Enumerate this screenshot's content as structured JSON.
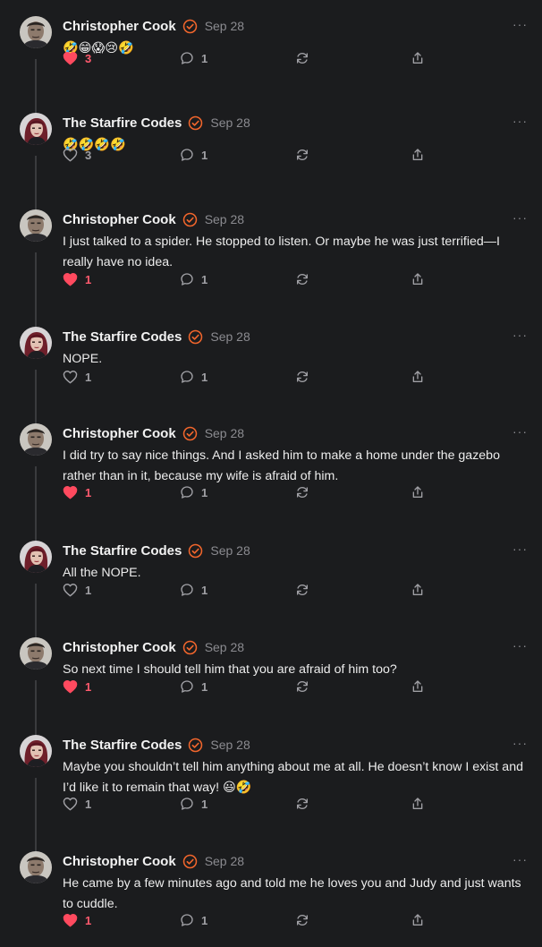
{
  "colors": {
    "background": "#1b1c1e",
    "text": "#ececec",
    "muted": "#8b8b90",
    "liked_heart": "#ff4a5f",
    "verified_badge": "#f2662c"
  },
  "icons": {
    "verified": "verified-badge-icon",
    "more": "more-options-icon",
    "like": "heart-icon",
    "comment": "comment-icon",
    "restack": "restack-icon",
    "share": "share-icon"
  },
  "comments": [
    {
      "author": "Christopher Cook",
      "date": "Sep 28",
      "body": "🤣😁😱😢🤣",
      "likes": "3",
      "liked": true,
      "comments": "1",
      "more": "···"
    },
    {
      "author": "The Starfire Codes",
      "date": "Sep 28",
      "body": "🤣🤣🤣🤣",
      "likes": "3",
      "liked": false,
      "comments": "1",
      "more": "···"
    },
    {
      "author": "Christopher Cook",
      "date": "Sep 28",
      "body": "I just talked to a spider. He stopped to listen. Or maybe he was just terrified—I really have no idea.",
      "likes": "1",
      "liked": true,
      "comments": "1",
      "more": "···"
    },
    {
      "author": "The Starfire Codes",
      "date": "Sep 28",
      "body": "NOPE.",
      "likes": "1",
      "liked": false,
      "comments": "1",
      "more": "···"
    },
    {
      "author": "Christopher Cook",
      "date": "Sep 28",
      "body": "I did try to say nice things. And I asked him to make a home under the gazebo rather than in it, because my wife is afraid of him.",
      "likes": "1",
      "liked": true,
      "comments": "1",
      "more": "···"
    },
    {
      "author": "The Starfire Codes",
      "date": "Sep 28",
      "body": "All the NOPE.",
      "likes": "1",
      "liked": false,
      "comments": "1",
      "more": "···"
    },
    {
      "author": "Christopher Cook",
      "date": "Sep 28",
      "body": "So next time I should tell him that you are afraid of him too?",
      "likes": "1",
      "liked": true,
      "comments": "1",
      "more": "···"
    },
    {
      "author": "The Starfire Codes",
      "date": "Sep 28",
      "body": "Maybe you shouldn’t tell him anything about me at all. He doesn’t know I exist and I’d like it to remain that way! 😃🤣",
      "likes": "1",
      "liked": false,
      "comments": "1",
      "more": "···"
    },
    {
      "author": "Christopher Cook",
      "date": "Sep 28",
      "body": "He came by a few minutes ago and told me he loves you and Judy and just wants to cuddle.",
      "likes": "1",
      "liked": true,
      "comments": "1",
      "more": "···"
    }
  ]
}
